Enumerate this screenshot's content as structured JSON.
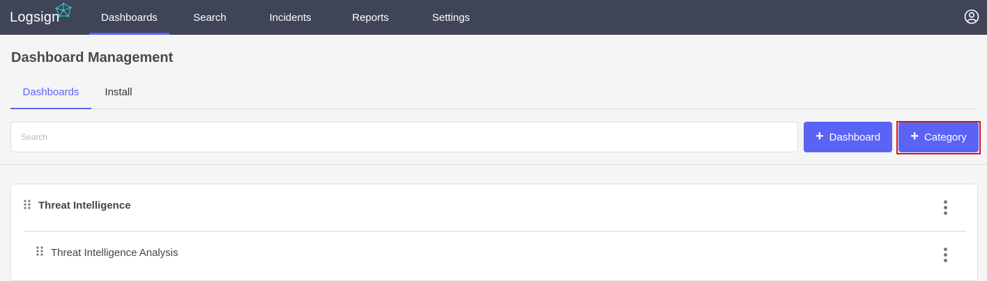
{
  "app": {
    "logo_text": "Logsign"
  },
  "nav": {
    "items": [
      {
        "label": "Dashboards",
        "active": true
      },
      {
        "label": "Search",
        "active": false
      },
      {
        "label": "Incidents",
        "active": false
      },
      {
        "label": "Reports",
        "active": false
      },
      {
        "label": "Settings",
        "active": false
      }
    ],
    "user_icon": "user-circle-icon"
  },
  "page": {
    "title": "Dashboard Management",
    "tabs": [
      {
        "label": "Dashboards",
        "active": true
      },
      {
        "label": "Install",
        "active": false
      }
    ]
  },
  "toolbar": {
    "search_placeholder": "Search",
    "search_value": "",
    "add_dashboard_label": "Dashboard",
    "add_category_label": "Category",
    "plus_icon": "+"
  },
  "categories": [
    {
      "name": "Threat Intelligence",
      "dashboards": [
        {
          "name": "Threat Intelligence Analysis"
        }
      ]
    }
  ],
  "colors": {
    "topbar": "#3f4456",
    "accent": "#5b63f5",
    "highlight": "#e01010"
  }
}
